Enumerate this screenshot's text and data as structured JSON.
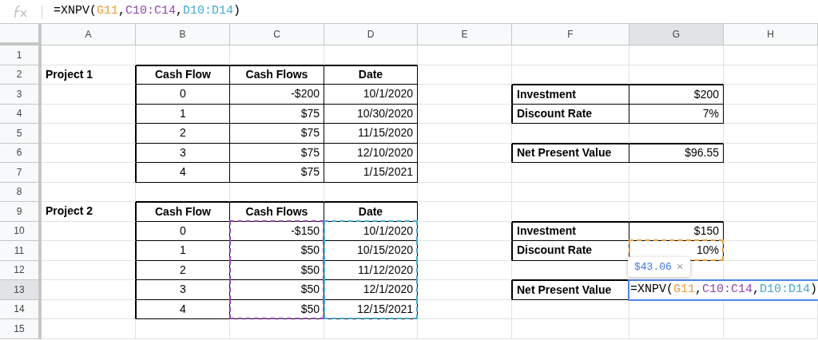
{
  "formula_bar": {
    "tokens": [
      {
        "text": "=XNPV("
      },
      {
        "text": "G11",
        "color": "#f39c34"
      },
      {
        "text": ","
      },
      {
        "text": "C10:C14",
        "color": "#8e44ad"
      },
      {
        "text": ","
      },
      {
        "text": "D10:D14",
        "color": "#3fa9d5"
      },
      {
        "text": ")"
      }
    ]
  },
  "columns": [
    {
      "label": "A",
      "selected": false
    },
    {
      "label": "B",
      "selected": false
    },
    {
      "label": "C",
      "selected": false
    },
    {
      "label": "D",
      "selected": false
    },
    {
      "label": "E",
      "selected": false
    },
    {
      "label": "F",
      "selected": false
    },
    {
      "label": "G",
      "selected": true
    },
    {
      "label": "H",
      "selected": false
    }
  ],
  "rows": [
    {
      "number": "1",
      "selected": false,
      "cells": [
        {
          "kind": "empty"
        },
        {
          "kind": "empty"
        },
        {
          "kind": "empty"
        },
        {
          "kind": "empty"
        },
        {
          "kind": "empty"
        },
        {
          "kind": "empty"
        },
        {
          "kind": "empty"
        },
        {
          "kind": "empty"
        }
      ]
    },
    {
      "number": "2",
      "selected": false,
      "cells": [
        {
          "kind": "title",
          "text": "Project 1"
        },
        {
          "kind": "header",
          "text": "Cash Flow"
        },
        {
          "kind": "header",
          "text": "Cash Flows"
        },
        {
          "kind": "header",
          "text": "Date"
        },
        {
          "kind": "empty"
        },
        {
          "kind": "empty"
        },
        {
          "kind": "empty"
        },
        {
          "kind": "empty"
        }
      ]
    },
    {
      "number": "3",
      "selected": false,
      "cells": [
        {
          "kind": "empty"
        },
        {
          "kind": "number",
          "text": "0"
        },
        {
          "kind": "value",
          "text": "-$200"
        },
        {
          "kind": "value",
          "text": "10/1/2020"
        },
        {
          "kind": "empty"
        },
        {
          "kind": "label",
          "text": "Investment"
        },
        {
          "kind": "value",
          "text": "$200"
        },
        {
          "kind": "empty"
        }
      ]
    },
    {
      "number": "4",
      "selected": false,
      "cells": [
        {
          "kind": "empty"
        },
        {
          "kind": "number",
          "text": "1"
        },
        {
          "kind": "value",
          "text": "$75"
        },
        {
          "kind": "value",
          "text": "10/30/2020"
        },
        {
          "kind": "empty"
        },
        {
          "kind": "label",
          "text": "Discount Rate"
        },
        {
          "kind": "value",
          "text": "7%"
        },
        {
          "kind": "empty"
        }
      ]
    },
    {
      "number": "5",
      "selected": false,
      "cells": [
        {
          "kind": "empty"
        },
        {
          "kind": "number",
          "text": "2"
        },
        {
          "kind": "value",
          "text": "$75"
        },
        {
          "kind": "value",
          "text": "11/15/2020"
        },
        {
          "kind": "empty"
        },
        {
          "kind": "empty"
        },
        {
          "kind": "empty"
        },
        {
          "kind": "empty"
        }
      ]
    },
    {
      "number": "6",
      "selected": false,
      "cells": [
        {
          "kind": "empty"
        },
        {
          "kind": "number",
          "text": "3"
        },
        {
          "kind": "value",
          "text": "$75"
        },
        {
          "kind": "value",
          "text": "12/10/2020"
        },
        {
          "kind": "empty"
        },
        {
          "kind": "label",
          "text": "Net Present Value"
        },
        {
          "kind": "value",
          "text": "$96.55"
        },
        {
          "kind": "empty"
        }
      ]
    },
    {
      "number": "7",
      "selected": false,
      "cells": [
        {
          "kind": "empty"
        },
        {
          "kind": "number",
          "text": "4"
        },
        {
          "kind": "value",
          "text": "$75"
        },
        {
          "kind": "value",
          "text": "1/15/2021"
        },
        {
          "kind": "empty"
        },
        {
          "kind": "empty"
        },
        {
          "kind": "empty"
        },
        {
          "kind": "empty"
        }
      ]
    },
    {
      "number": "8",
      "selected": false,
      "cells": [
        {
          "kind": "empty"
        },
        {
          "kind": "empty"
        },
        {
          "kind": "empty"
        },
        {
          "kind": "empty"
        },
        {
          "kind": "empty"
        },
        {
          "kind": "empty"
        },
        {
          "kind": "empty"
        },
        {
          "kind": "empty"
        }
      ]
    },
    {
      "number": "9",
      "selected": false,
      "cells": [
        {
          "kind": "title",
          "text": "Project 2"
        },
        {
          "kind": "header",
          "text": "Cash Flow"
        },
        {
          "kind": "header",
          "text": "Cash Flows"
        },
        {
          "kind": "header",
          "text": "Date"
        },
        {
          "kind": "empty"
        },
        {
          "kind": "empty"
        },
        {
          "kind": "empty"
        },
        {
          "kind": "empty"
        }
      ]
    },
    {
      "number": "10",
      "selected": false,
      "cells": [
        {
          "kind": "empty"
        },
        {
          "kind": "number",
          "text": "0"
        },
        {
          "kind": "value",
          "text": "-$150",
          "color": "#8e44ad"
        },
        {
          "kind": "value",
          "text": "10/1/2020",
          "color": "#3fa9d5"
        },
        {
          "kind": "empty"
        },
        {
          "kind": "label",
          "text": "Investment"
        },
        {
          "kind": "value",
          "text": "$150"
        },
        {
          "kind": "empty"
        }
      ]
    },
    {
      "number": "11",
      "selected": false,
      "cells": [
        {
          "kind": "empty"
        },
        {
          "kind": "number",
          "text": "1"
        },
        {
          "kind": "value",
          "text": "$50",
          "color": "#8e44ad"
        },
        {
          "kind": "value",
          "text": "10/15/2020",
          "color": "#3fa9d5"
        },
        {
          "kind": "empty"
        },
        {
          "kind": "label",
          "text": "Discount Rate"
        },
        {
          "kind": "value",
          "text": "10%",
          "color": "#f39c34"
        },
        {
          "kind": "empty"
        }
      ]
    },
    {
      "number": "12",
      "selected": false,
      "cells": [
        {
          "kind": "empty"
        },
        {
          "kind": "number",
          "text": "2"
        },
        {
          "kind": "value",
          "text": "$50",
          "color": "#8e44ad"
        },
        {
          "kind": "value",
          "text": "11/12/2020",
          "color": "#3fa9d5"
        },
        {
          "kind": "empty"
        },
        {
          "kind": "empty"
        },
        {
          "kind": "empty"
        },
        {
          "kind": "empty"
        }
      ]
    },
    {
      "number": "13",
      "selected": true,
      "cells": [
        {
          "kind": "empty"
        },
        {
          "kind": "number",
          "text": "3"
        },
        {
          "kind": "value",
          "text": "$50",
          "color": "#8e44ad"
        },
        {
          "kind": "value",
          "text": "12/1/2020",
          "color": "#3fa9d5"
        },
        {
          "kind": "empty"
        },
        {
          "kind": "label",
          "text": "Net Present Value"
        },
        {
          "kind": "editing"
        },
        {
          "kind": "covered"
        }
      ]
    },
    {
      "number": "14",
      "selected": false,
      "cells": [
        {
          "kind": "empty"
        },
        {
          "kind": "number",
          "text": "4"
        },
        {
          "kind": "value",
          "text": "$50",
          "color": "#8e44ad"
        },
        {
          "kind": "value",
          "text": "12/15/2021",
          "color": "#3fa9d5"
        },
        {
          "kind": "empty"
        },
        {
          "kind": "empty"
        },
        {
          "kind": "empty"
        },
        {
          "kind": "empty"
        }
      ]
    },
    {
      "number": "15",
      "selected": false,
      "cells": [
        {
          "kind": "empty"
        },
        {
          "kind": "empty"
        },
        {
          "kind": "empty"
        },
        {
          "kind": "empty"
        },
        {
          "kind": "empty"
        },
        {
          "kind": "empty"
        },
        {
          "kind": "empty"
        },
        {
          "kind": "empty"
        }
      ]
    }
  ],
  "cell_editor": {
    "tokens": [
      {
        "text": "=XNPV("
      },
      {
        "text": "G11",
        "color": "#f39c34"
      },
      {
        "text": ","
      },
      {
        "text": "C10:C14",
        "color": "#8e44ad"
      },
      {
        "text": ","
      },
      {
        "text": "D10:D14",
        "color": "#3fa9d5"
      },
      {
        "text": ")"
      }
    ],
    "preview": {
      "value": "$43.06",
      "close": "×"
    }
  }
}
